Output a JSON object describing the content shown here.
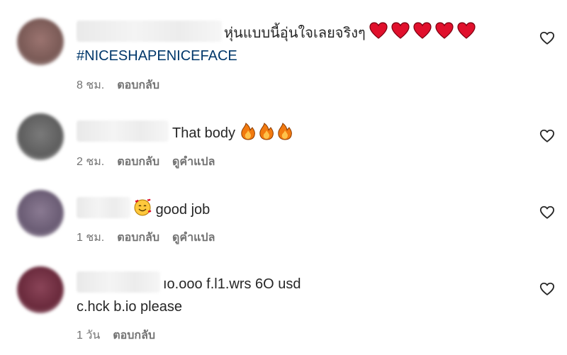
{
  "comments": [
    {
      "text": "หุ่นแบบนี้อุ่นใจเลยจริงๆ",
      "emojis": [
        "heart",
        "heart",
        "heart",
        "heart",
        "heart"
      ],
      "hashtag": "#NICESHAPENICEFACE",
      "time": "8 ชม.",
      "reply": "ตอบกลับ",
      "translate": "",
      "avatar_color": "#8a6a66"
    },
    {
      "text": "That body",
      "emojis": [
        "fire",
        "fire",
        "fire"
      ],
      "time": "2 ชม.",
      "reply": "ตอบกลับ",
      "translate": "ดูคำแปล",
      "avatar_color": "#6f6f6f"
    },
    {
      "text": "good job",
      "emojis": [
        "smiling-hearts"
      ],
      "time": "1 ชม.",
      "reply": "ตอบกลับ",
      "translate": "ดูคำแปล",
      "avatar_color": "#7a6f86"
    },
    {
      "text": "ıo.ooo f.l1.wrs 6O usd",
      "line2": "c.hck b.io please",
      "time": "1 วัน",
      "reply": "ตอบกลับ",
      "translate": "",
      "avatar_color": "#7a3a4c"
    }
  ],
  "icons": {
    "like": "heart-outline-icon"
  },
  "colors": {
    "hashtag": "#00376b",
    "meta": "#737373",
    "text": "#262626"
  }
}
